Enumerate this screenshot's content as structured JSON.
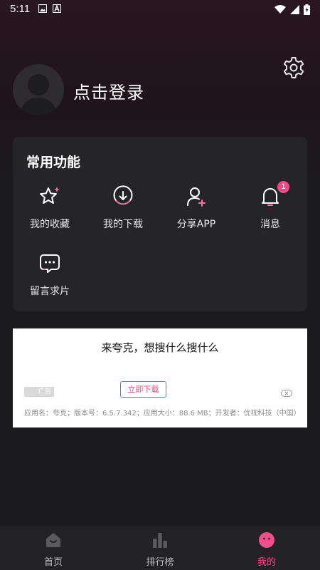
{
  "status_bar": {
    "time": "5:11"
  },
  "profile": {
    "login_text": "点击登录"
  },
  "functions": {
    "title": "常用功能",
    "items": [
      {
        "label": "我的收藏",
        "icon": "star-sparkle-icon"
      },
      {
        "label": "我的下载",
        "icon": "download-icon"
      },
      {
        "label": "分享APP",
        "icon": "add-user-icon"
      },
      {
        "label": "消息",
        "icon": "bell-icon",
        "badge": "1"
      },
      {
        "label": "留言求片",
        "icon": "message-icon"
      }
    ]
  },
  "ad": {
    "title": "来夸克，想搜什么搜什么",
    "button": "立即下载",
    "tag": "广告",
    "info": "应用名：夸克；版本号：6.5.7.342；应用大小：88.6 MB；开发者：优视科技（中国）"
  },
  "nav": {
    "items": [
      {
        "label": "首页",
        "icon": "home-icon"
      },
      {
        "label": "排行榜",
        "icon": "ranking-icon"
      },
      {
        "label": "我的",
        "icon": "me-face-icon",
        "active": true
      }
    ]
  },
  "colors": {
    "accent": "#ef4f8c",
    "card": "#252527",
    "background": "#1b1b1d"
  }
}
